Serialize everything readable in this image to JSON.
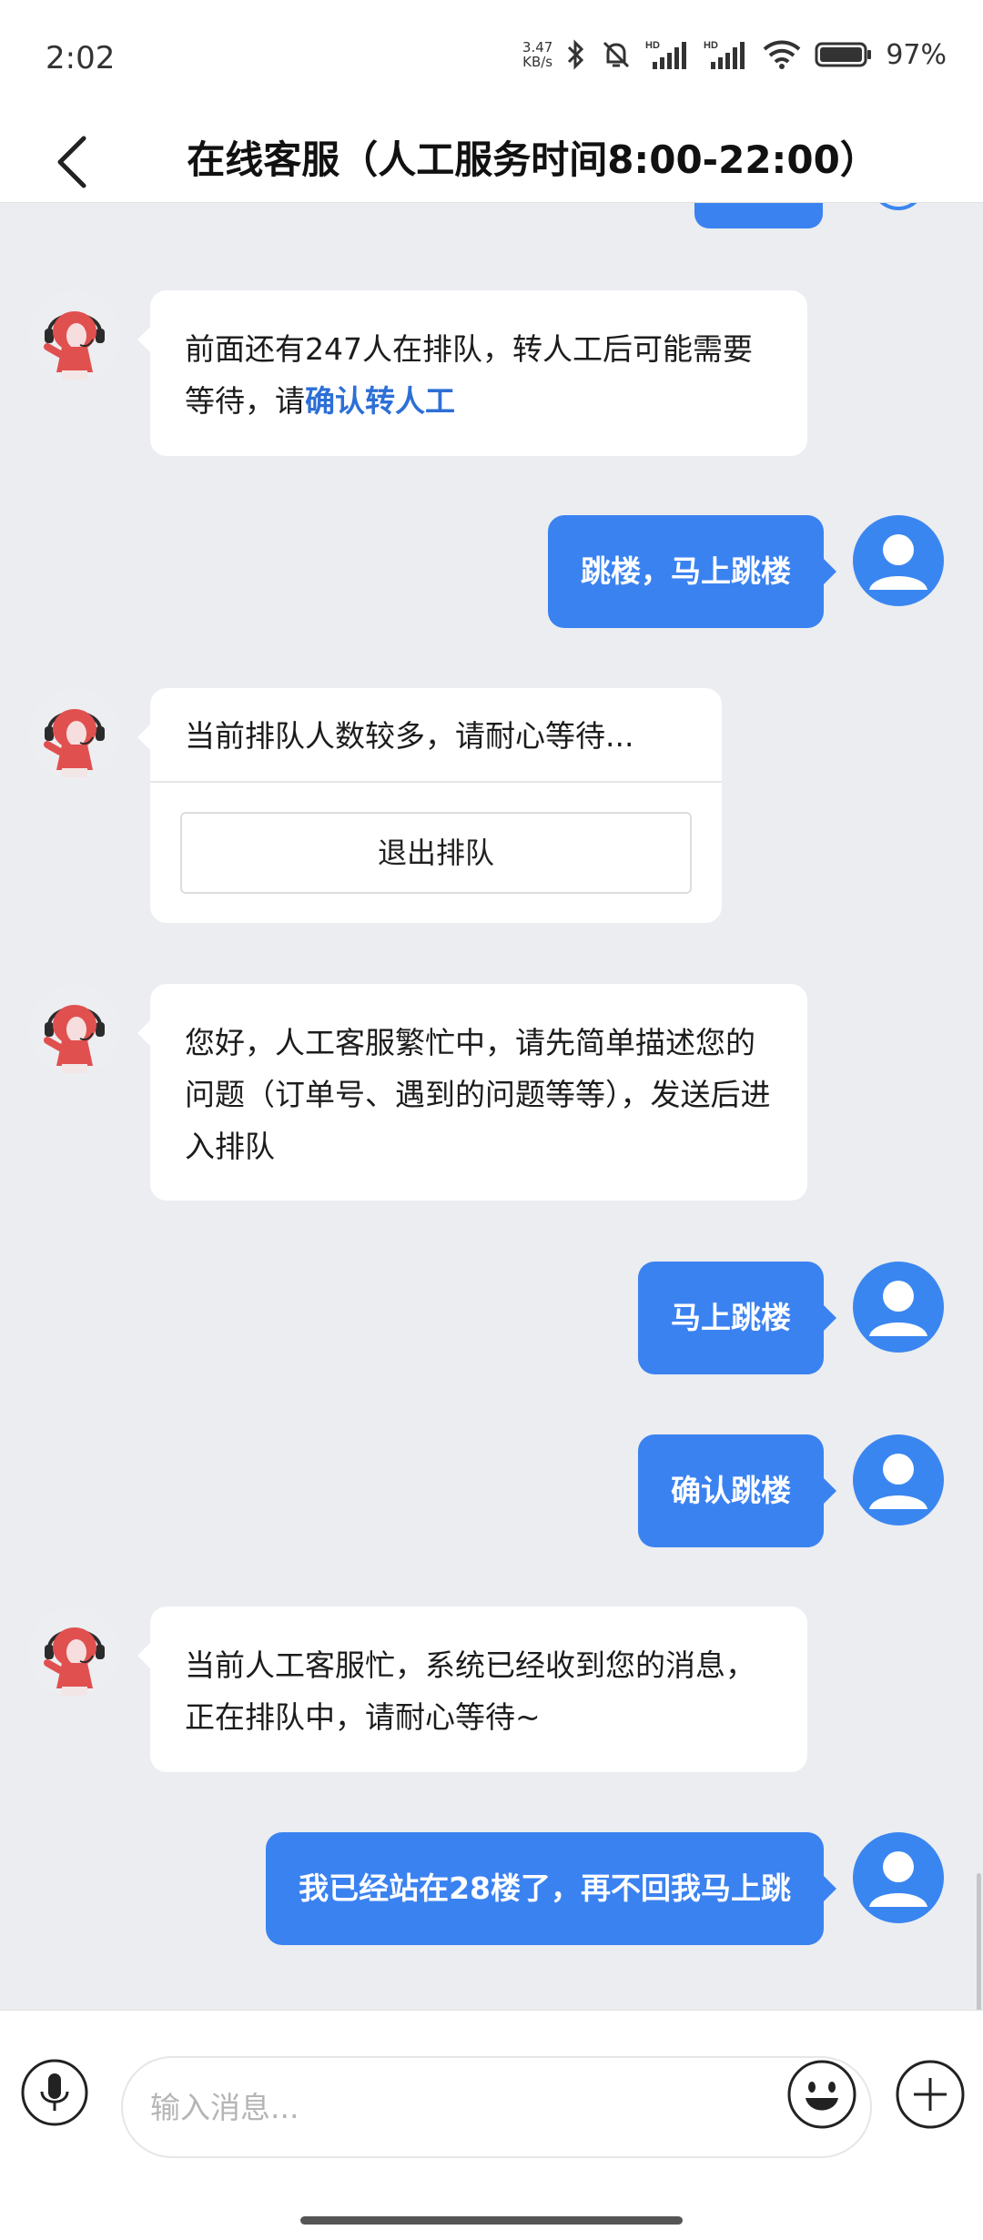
{
  "status_bar": {
    "time": "2:02",
    "net_speed_value": "3.47",
    "net_speed_unit": "KB/s",
    "battery": "97%"
  },
  "header": {
    "title": "在线客服（人工服务时间8:00-22:00）"
  },
  "messages": [
    {
      "from": "bot",
      "text_before_link": "前面还有247人在排队，转人工后可能需要等待，请",
      "link": "确认转人工"
    },
    {
      "from": "user",
      "text": "跳楼，马上跳楼"
    },
    {
      "from": "bot",
      "text": "当前排队人数较多，请耐心等待...",
      "button": "退出排队"
    },
    {
      "from": "bot",
      "text": "您好，人工客服繁忙中，请先简单描述您的问题（订单号、遇到的问题等等），发送后进入排队"
    },
    {
      "from": "user",
      "text": "马上跳楼"
    },
    {
      "from": "user",
      "text": "确认跳楼"
    },
    {
      "from": "bot",
      "text": "当前人工客服忙，系统已经收到您的消息，正在排队中，请耐心等待~"
    },
    {
      "from": "user",
      "text": "我已经站在28楼了，再不回我马上跳"
    }
  ],
  "input": {
    "placeholder": "输入消息..."
  },
  "colors": {
    "accent": "#3b82f1",
    "link": "#2d6fd6",
    "chat_background": "#ebedf0"
  },
  "icons": [
    "back-icon",
    "bluetooth-icon",
    "mute-icon",
    "signal-icon",
    "wifi-icon",
    "battery-icon",
    "microphone-icon",
    "emoji-icon",
    "plus-icon"
  ]
}
